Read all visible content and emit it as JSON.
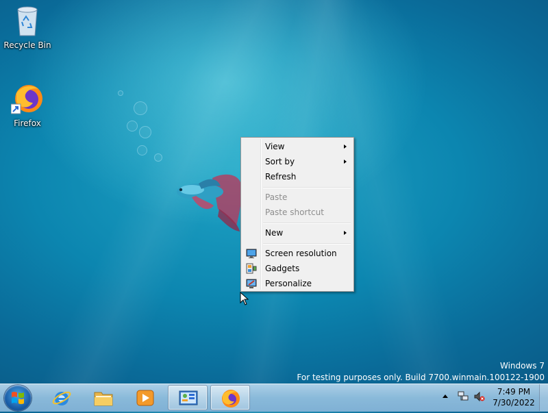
{
  "desktop": {
    "icons": [
      {
        "label": "Recycle Bin",
        "icon": "recycle-bin-icon"
      },
      {
        "label": "Firefox",
        "icon": "firefox-icon"
      }
    ]
  },
  "context_menu": {
    "items": [
      {
        "label": "View",
        "submenu": true,
        "enabled": true
      },
      {
        "label": "Sort by",
        "submenu": true,
        "enabled": true
      },
      {
        "label": "Refresh",
        "submenu": false,
        "enabled": true
      },
      {
        "label": "Paste",
        "submenu": false,
        "enabled": false
      },
      {
        "label": "Paste shortcut",
        "submenu": false,
        "enabled": false
      },
      {
        "label": "New",
        "submenu": true,
        "enabled": true
      },
      {
        "label": "Screen resolution",
        "submenu": false,
        "enabled": true,
        "icon": "screen-resolution-icon"
      },
      {
        "label": "Gadgets",
        "submenu": false,
        "enabled": true,
        "icon": "gadgets-icon"
      },
      {
        "label": "Personalize",
        "submenu": false,
        "enabled": true,
        "icon": "personalize-icon"
      }
    ]
  },
  "watermark": {
    "line1": "Windows 7",
    "line2": "For testing purposes only. Build 7700.winmain.100122-1900"
  },
  "taskbar": {
    "pinned": [
      {
        "name": "internet-explorer",
        "icon": "internet-explorer-icon"
      },
      {
        "name": "windows-explorer",
        "icon": "folder-icon"
      },
      {
        "name": "media-player",
        "icon": "media-player-icon"
      },
      {
        "name": "control-panel",
        "icon": "control-panel-icon",
        "active": true
      },
      {
        "name": "firefox",
        "icon": "firefox-icon",
        "active": true
      }
    ],
    "tray": {
      "icons": [
        "network-icon",
        "volume-muted-icon"
      ],
      "time": "7:49 PM",
      "date": "7/30/2022"
    }
  },
  "colors": {
    "menu_background": "#f0f0f0",
    "disabled_text": "#8d8d8d",
    "desktop_blue": "#0c86b0"
  }
}
